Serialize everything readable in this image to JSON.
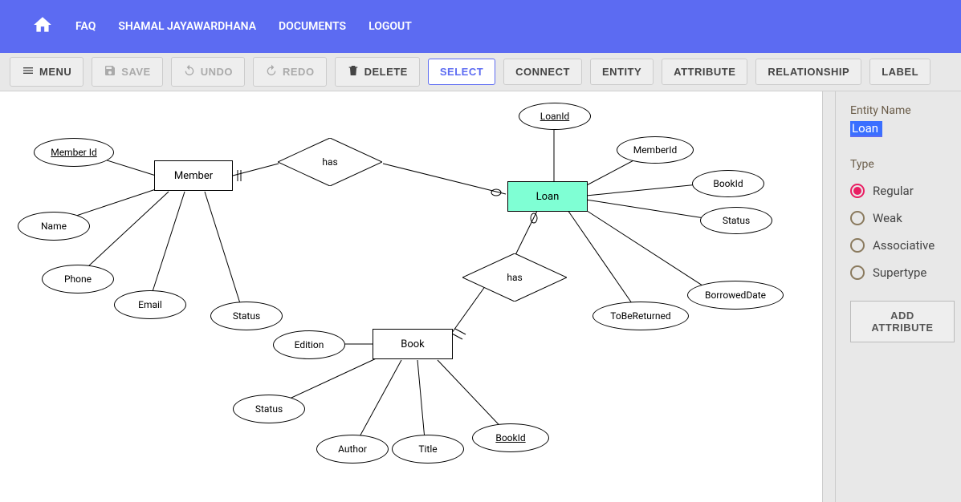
{
  "topbar": {
    "items": [
      "FAQ",
      "SHAMAL JAYAWARDHANA",
      "DOCUMENTS",
      "LOGOUT"
    ]
  },
  "toolbar": {
    "menu": "MENU",
    "save": "SAVE",
    "undo": "UNDO",
    "redo": "REDO",
    "delete": "DELETE",
    "select": "SELECT",
    "connect": "CONNECT",
    "entity": "ENTITY",
    "attribute": "ATTRIBUTE",
    "relationship": "RELATIONSHIP",
    "label": "LABEL"
  },
  "sidepanel": {
    "entityNameLabel": "Entity Name",
    "entityNameValue": "Loan",
    "typeLabel": "Type",
    "types": [
      "Regular",
      "Weak",
      "Associative",
      "Supertype"
    ],
    "selectedType": "Regular",
    "addAttribute": "ADD ATTRIBUTE"
  },
  "diagram": {
    "entities": [
      {
        "id": "member",
        "label": "Member"
      },
      {
        "id": "loan",
        "label": "Loan",
        "selected": true
      },
      {
        "id": "book",
        "label": "Book"
      }
    ],
    "relationships": [
      {
        "id": "has1",
        "label": "has"
      },
      {
        "id": "has2",
        "label": "has"
      }
    ],
    "attributes": {
      "member": [
        {
          "label": "Member Id",
          "key": true
        },
        {
          "label": "Name"
        },
        {
          "label": "Phone"
        },
        {
          "label": "Email"
        },
        {
          "label": "Status"
        }
      ],
      "loan": [
        {
          "label": "LoanId",
          "key": true
        },
        {
          "label": "MemberId"
        },
        {
          "label": "BookId"
        },
        {
          "label": "Status"
        },
        {
          "label": "BorrowedDate"
        },
        {
          "label": "ToBeReturned"
        }
      ],
      "book": [
        {
          "label": "Edition"
        },
        {
          "label": "Status"
        },
        {
          "label": "Author"
        },
        {
          "label": "Title"
        },
        {
          "label": "BookId",
          "key": true
        }
      ]
    }
  }
}
